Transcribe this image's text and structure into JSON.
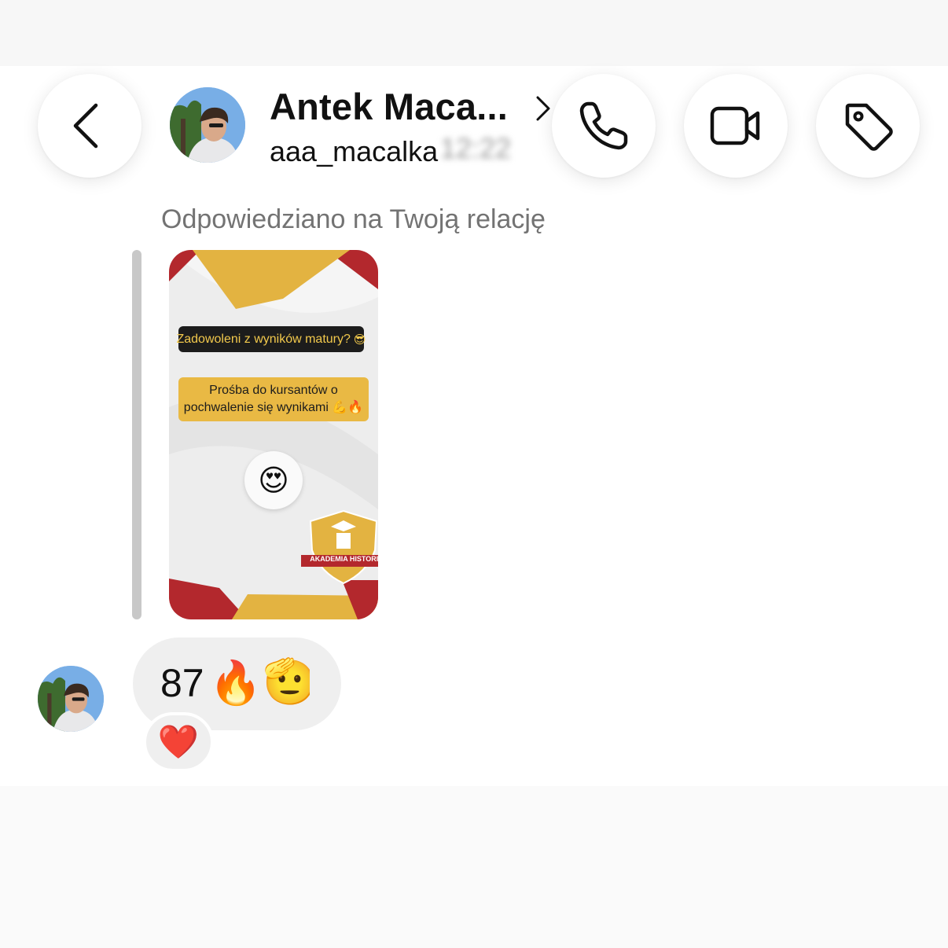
{
  "header": {
    "name": "Antek Maca...",
    "username": "aaa_macalka",
    "time": "12:22",
    "icons": {
      "back": "chevron-left-icon",
      "profile": "chevron-right-icon",
      "call": "phone-icon",
      "video": "video-camera-icon",
      "tag": "tag-icon"
    }
  },
  "conversation": {
    "reply_label": "Odpowiedziano na Twoją relację",
    "story": {
      "question": "Zadowoleni z wyników matury?",
      "question_emoji": "😎",
      "request": "Prośba do kursantów o pochwalenie się wynikami",
      "request_emoji": "💪🔥",
      "reaction": "😍",
      "logo_text": "AKADEMIA HISTORII",
      "colors": {
        "red": "#b3282d",
        "gold": "#e3b341",
        "dark": "#1c1c1c"
      }
    },
    "message": {
      "text": "87",
      "emoji_1": "🔥",
      "emoji_2": "🫡",
      "reaction": "❤️"
    }
  }
}
